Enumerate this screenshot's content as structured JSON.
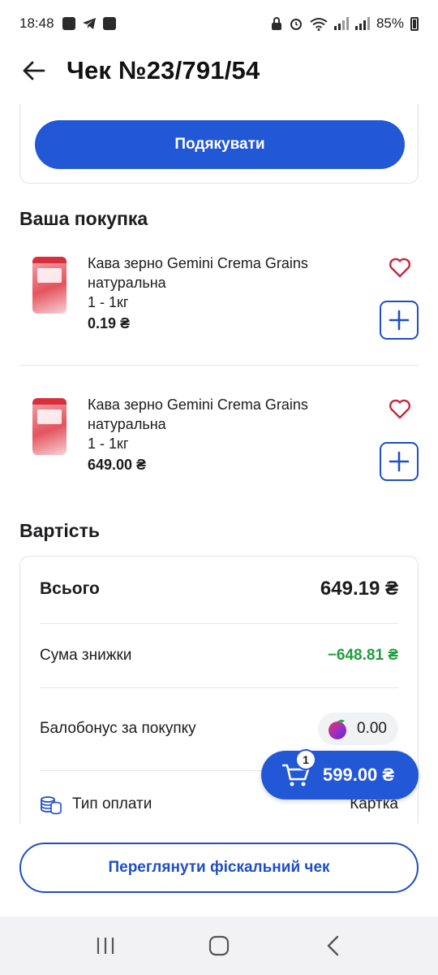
{
  "status_bar": {
    "time": "18:48",
    "battery": "85%"
  },
  "header": {
    "title": "Чек №23/791/54"
  },
  "thank_button": {
    "label": "Подякувати"
  },
  "purchase": {
    "title": "Ваша покупка",
    "items": [
      {
        "name": "Кава зерно Gemini Crema Grains натуральна",
        "qty": "1 - 1кг",
        "price": "0.19 ₴"
      },
      {
        "name": "Кава зерно Gemini Crema Grains натуральна",
        "qty": "1 - 1кг",
        "price": "649.00 ₴"
      }
    ]
  },
  "cost": {
    "title": "Вартість",
    "total_label": "Всього",
    "total_value": "649.19 ₴",
    "discount_label": "Сума знижки",
    "discount_value": "−648.81 ₴",
    "bonus_label": "Балобонус за покупку",
    "bonus_value": "0.00",
    "payment_label": "Тип оплати",
    "payment_value": "Картка"
  },
  "cart": {
    "count": "1",
    "total": "599.00 ₴"
  },
  "fiscal_button": {
    "label": "Переглянути фіскальний чек"
  },
  "colors": {
    "accent": "#2257d6",
    "discount": "#1f9e3a",
    "heart": "#c8263d"
  },
  "icons": [
    "back-arrow-icon",
    "heart-icon",
    "plus-icon",
    "coins-icon",
    "cart-icon",
    "plum-icon",
    "recents-icon",
    "home-icon",
    "back-icon"
  ]
}
